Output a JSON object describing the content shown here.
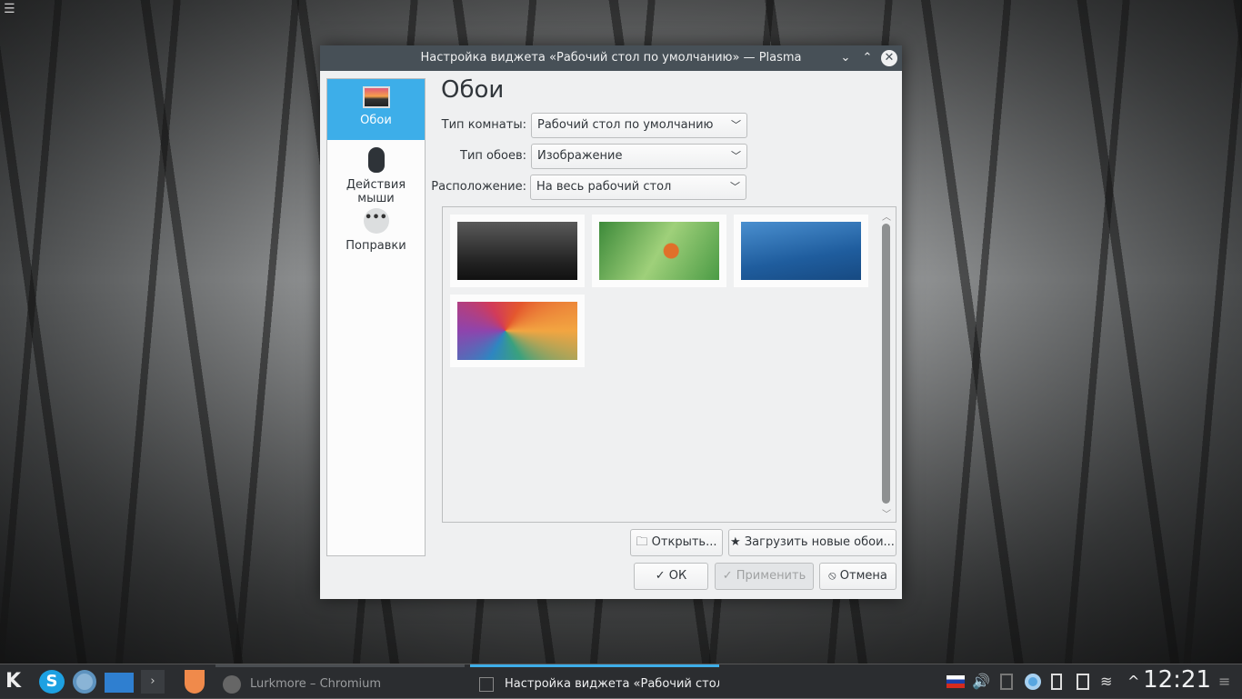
{
  "window": {
    "title": "Настройка виджета «Рабочий стол по умолчанию» — Plasma",
    "minimize": "⌄",
    "maximize": "⌃",
    "close": "✕"
  },
  "sidebar": {
    "items": [
      {
        "label": "Обои",
        "icon": "wallpaper-icon",
        "active": true
      },
      {
        "label": "Действия мыши",
        "icon": "mouse-icon"
      },
      {
        "label": "Поправки",
        "icon": "more-icon"
      }
    ]
  },
  "page": {
    "heading": "Обои",
    "fields": [
      {
        "label": "Тип комнаты:",
        "value": "Рабочий стол по умолчанию"
      },
      {
        "label": "Тип обоев:",
        "value": "Изображение"
      },
      {
        "label": "Расположение:",
        "value": "На весь рабочий стол"
      }
    ],
    "wallpapers": [
      "dark-forest",
      "green-frog-leaf",
      "blue-waves",
      "colorful-polygons"
    ],
    "buttons": {
      "open": "Открыть...",
      "download": "Загрузить новые обои...",
      "ok": "ОК",
      "apply": "Применить",
      "cancel": "Отмена"
    }
  },
  "taskbar": {
    "tasks": [
      "Lurkmore – Chromium",
      "Настройка виджета «Рабочий стол по умолчанию» — Plasma"
    ],
    "clock": "12:21",
    "accent": "#3daee9"
  }
}
